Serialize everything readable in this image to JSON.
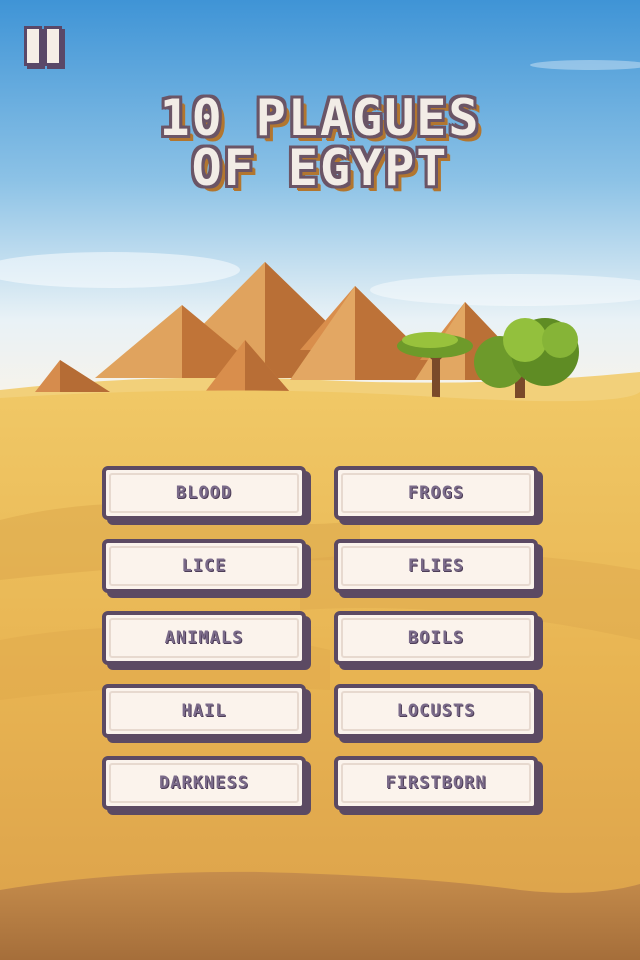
{
  "title": {
    "line1": "10 PLAGUES",
    "line2": "OF EGYPT"
  },
  "pause": {
    "icon": "pause-icon"
  },
  "plagues": [
    "BLOOD",
    "FROGS",
    "LICE",
    "FLIES",
    "ANIMALS",
    "BOILS",
    "HAIL",
    "LOCUSTS",
    "DARKNESS",
    "FIRSTBORN"
  ],
  "colors": {
    "sky_top": "#4ea0dc",
    "sky_bottom": "#f4f6f4",
    "sand": "#e9b651",
    "sand_dark": "#b9874a",
    "pyramid": "#d68a4a",
    "button_bg": "#fbf3ec",
    "button_border": "#5c4a63",
    "button_text": "#7b6b8a"
  }
}
